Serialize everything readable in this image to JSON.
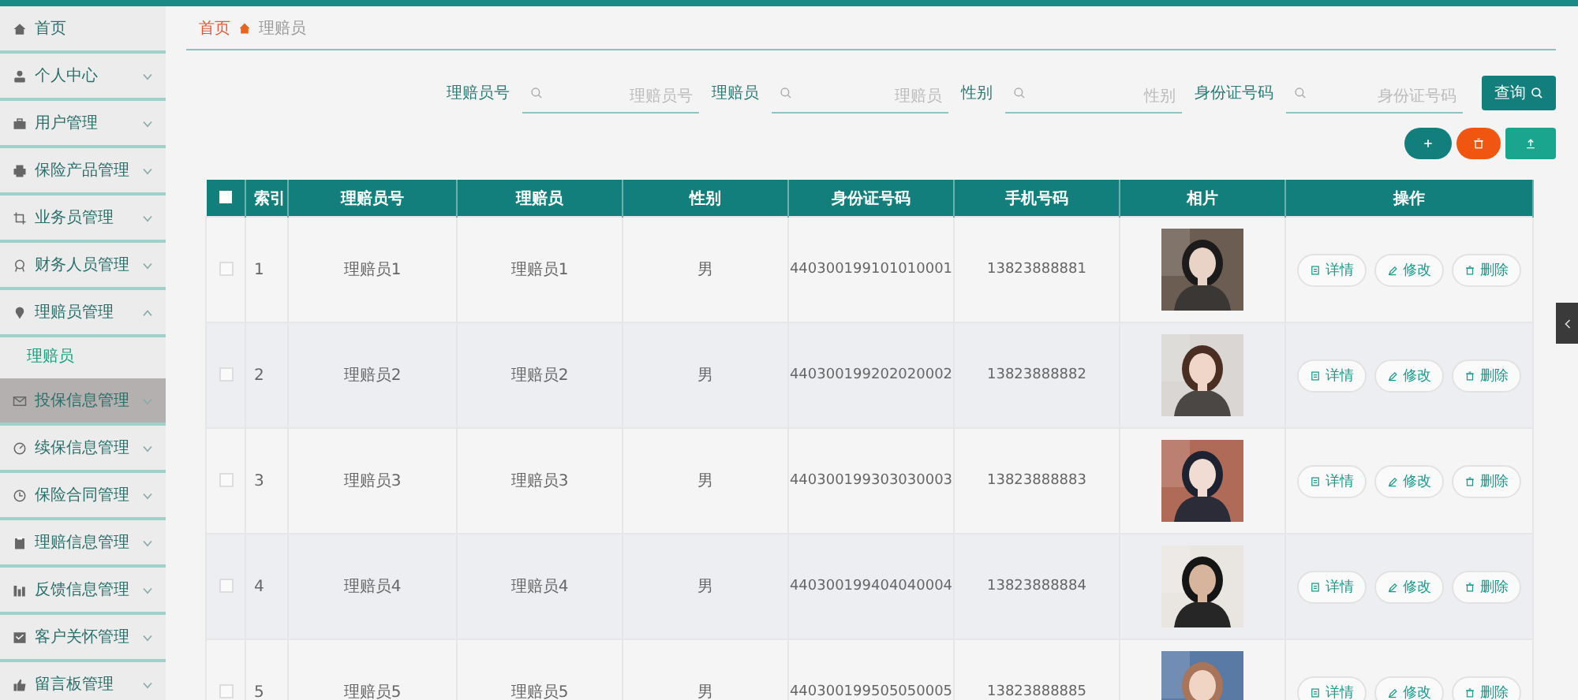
{
  "sidebar": {
    "items": [
      {
        "label": "首页",
        "expandable": false,
        "highlighted": false
      },
      {
        "label": "个人中心",
        "expandable": true,
        "expanded": false,
        "highlighted": false
      },
      {
        "label": "用户管理",
        "expandable": true,
        "expanded": false,
        "highlighted": false
      },
      {
        "label": "保险产品管理",
        "expandable": true,
        "expanded": false,
        "highlighted": false
      },
      {
        "label": "业务员管理",
        "expandable": true,
        "expanded": false,
        "highlighted": false
      },
      {
        "label": "财务人员管理",
        "expandable": true,
        "expanded": false,
        "highlighted": false
      },
      {
        "label": "理赔员管理",
        "expandable": true,
        "expanded": true,
        "highlighted": false,
        "children": [
          {
            "label": "理赔员",
            "selected": true
          }
        ]
      },
      {
        "label": "投保信息管理",
        "expandable": true,
        "expanded": false,
        "highlighted": true
      },
      {
        "label": "续保信息管理",
        "expandable": true,
        "expanded": false,
        "highlighted": false
      },
      {
        "label": "保险合同管理",
        "expandable": true,
        "expanded": false,
        "highlighted": false
      },
      {
        "label": "理赔信息管理",
        "expandable": true,
        "expanded": false,
        "highlighted": false
      },
      {
        "label": "反馈信息管理",
        "expandable": true,
        "expanded": false,
        "highlighted": false
      },
      {
        "label": "客户关怀管理",
        "expandable": true,
        "expanded": false,
        "highlighted": false
      },
      {
        "label": "留言板管理",
        "expandable": true,
        "expanded": false,
        "highlighted": false
      }
    ]
  },
  "breadcrumb": {
    "home": "首页",
    "current": "理赔员"
  },
  "search": {
    "fields": [
      {
        "label": "理赔员号",
        "placeholder": "理赔员号"
      },
      {
        "label": "理赔员",
        "placeholder": "理赔员"
      },
      {
        "label": "性别",
        "placeholder": "性别"
      },
      {
        "label": "身份证号码",
        "placeholder": "身份证号码"
      }
    ],
    "button": "查询"
  },
  "table": {
    "header_checked": false,
    "columns": [
      "索引",
      "理赔员号",
      "理赔员",
      "性别",
      "身份证号码",
      "手机号码",
      "相片",
      "操作"
    ],
    "rows": [
      {
        "checked": false,
        "index": "1",
        "id": "理赔员1",
        "name": "理赔员1",
        "gender": "男",
        "id_number": "440300199101010001",
        "phone": "13823888881",
        "photo": {
          "kind": "picture"
        },
        "actions": [
          "详情",
          "修改",
          "删除"
        ]
      },
      {
        "checked": false,
        "index": "2",
        "id": "理赔员2",
        "name": "理赔员2",
        "gender": "男",
        "id_number": "440300199202020002",
        "phone": "13823888882",
        "photo": {
          "kind": "picture"
        },
        "actions": [
          "详情",
          "修改",
          "删除"
        ]
      },
      {
        "checked": false,
        "index": "3",
        "id": "理赔员3",
        "name": "理赔员3",
        "gender": "男",
        "id_number": "440300199303030003",
        "phone": "13823888883",
        "photo": {
          "kind": "picture"
        },
        "actions": [
          "详情",
          "修改",
          "删除"
        ]
      },
      {
        "checked": false,
        "index": "4",
        "id": "理赔员4",
        "name": "理赔员4",
        "gender": "男",
        "id_number": "440300199404040004",
        "phone": "13823888884",
        "photo": {
          "kind": "picture"
        },
        "actions": [
          "详情",
          "修改",
          "删除"
        ]
      },
      {
        "checked": false,
        "index": "5",
        "id": "理赔员5",
        "name": "理赔员5",
        "gender": "男",
        "id_number": "440300199505050005",
        "phone": "13823888885",
        "photo": {
          "kind": "picture"
        },
        "actions": [
          "详情",
          "修改",
          "删除"
        ]
      }
    ]
  }
}
